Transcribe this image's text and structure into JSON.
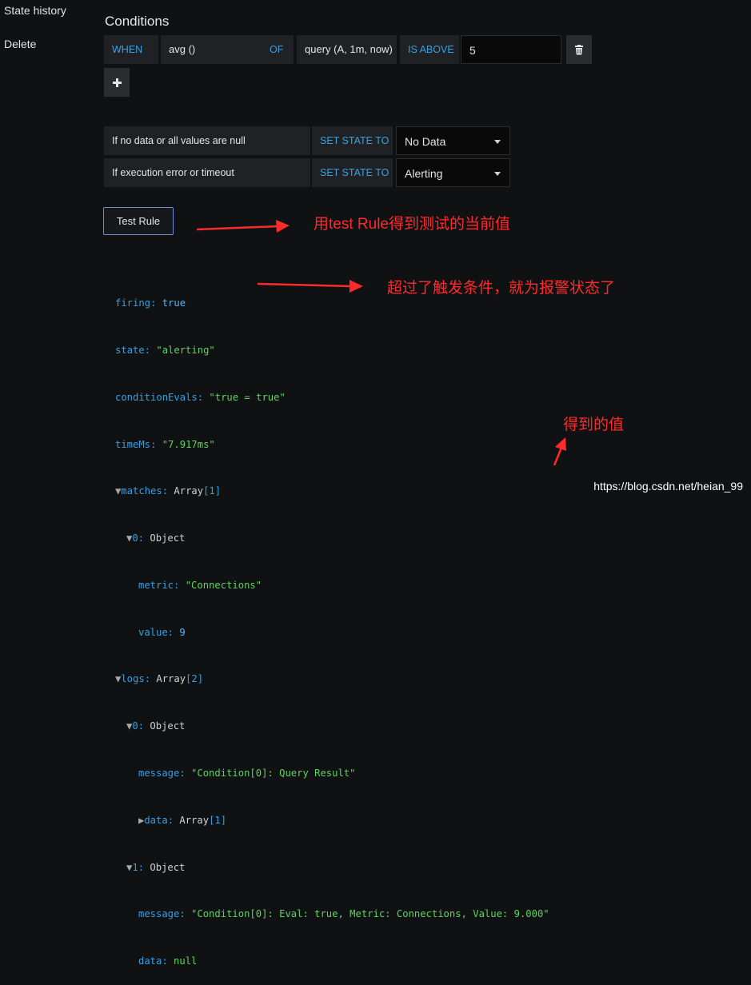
{
  "sidebar": {
    "items": [
      "State history",
      "Delete"
    ]
  },
  "conditions": {
    "title": "Conditions",
    "when": "WHEN",
    "func": "avg ()",
    "of": "OF",
    "query": "query (A, 1m, now)",
    "evaluator": "IS ABOVE",
    "threshold": "5",
    "add_icon": "plus-icon",
    "remove_icon": "trash-icon"
  },
  "no_data": {
    "label": "If no data or all values are null",
    "set_state": "SET STATE TO",
    "value": "No Data"
  },
  "exec_error": {
    "label": "If execution error or timeout",
    "set_state": "SET STATE TO",
    "value": "Alerting"
  },
  "test_rule": {
    "label": "Test Rule"
  },
  "test_result": {
    "firing_key": "firing:",
    "firing_val": "true",
    "state_key": "state:",
    "state_val": "\"alerting\"",
    "evals_key": "conditionEvals:",
    "evals_val": "\"true = true\"",
    "time_key": "timeMs:",
    "time_val": "\"7.917ms\"",
    "matches_key": "matches:",
    "matches_type": "Array",
    "matches_len": "[1]",
    "m0_key": "0:",
    "m0_type": "Object",
    "metric_key": "metric:",
    "metric_val": "\"Connections\"",
    "value_key": "value:",
    "value_val": "9",
    "logs_key": "logs:",
    "logs_type": "Array",
    "logs_len": "[2]",
    "l0_key": "0:",
    "l0_type": "Object",
    "msg0_key": "message:",
    "msg0_val": "\"Condition[0]: Query Result\"",
    "data_key": "data:",
    "data_type": "Array",
    "data_len": "[1]",
    "l1_key": "1:",
    "l1_type": "Object",
    "msg1_key": "message:",
    "msg1_val": "\"Condition[0]: Eval: true, Metric: Connections, Value: 9.000\"",
    "data2_key": "data:",
    "data2_val": "null"
  },
  "annotations": {
    "a1": "用test Rule得到测试的当前值",
    "a2": "超过了触发条件，就为报警状态了",
    "a3": "得到的值"
  },
  "watermark": "https://blog.csdn.net/heian_99",
  "colors": {
    "accent": "#33a2e5",
    "json_string": "#5fd35f",
    "annotation": "#ff2a2a",
    "button_border": "#6b8fd6"
  }
}
